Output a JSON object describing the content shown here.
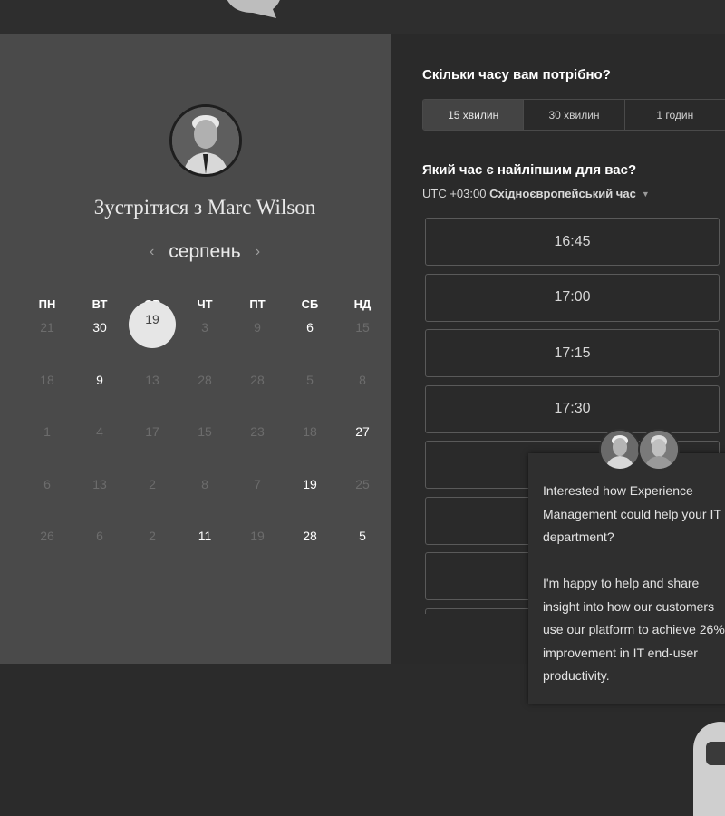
{
  "left": {
    "title": "Зустрітися з Marc Wilson",
    "month": "серпень",
    "weekdays": [
      "ПН",
      "ВТ",
      "СР",
      "ЧТ",
      "ПТ",
      "СБ",
      "НД"
    ],
    "weeks": [
      [
        {
          "d": "21",
          "a": false
        },
        {
          "d": "30",
          "a": true
        },
        {
          "d": "19",
          "a": true,
          "sel": true
        },
        {
          "d": "3",
          "a": false
        },
        {
          "d": "9",
          "a": false
        },
        {
          "d": "6",
          "a": true
        },
        {
          "d": "15",
          "a": false
        }
      ],
      [
        {
          "d": "18",
          "a": false
        },
        {
          "d": "9",
          "a": true
        },
        {
          "d": "13",
          "a": false
        },
        {
          "d": "28",
          "a": false
        },
        {
          "d": "28",
          "a": false
        },
        {
          "d": "5",
          "a": false
        },
        {
          "d": "8",
          "a": false
        }
      ],
      [
        {
          "d": "1",
          "a": false
        },
        {
          "d": "4",
          "a": false
        },
        {
          "d": "17",
          "a": false
        },
        {
          "d": "15",
          "a": false
        },
        {
          "d": "23",
          "a": false
        },
        {
          "d": "18",
          "a": false
        },
        {
          "d": "27",
          "a": true
        }
      ],
      [
        {
          "d": "6",
          "a": false
        },
        {
          "d": "13",
          "a": false
        },
        {
          "d": "2",
          "a": false
        },
        {
          "d": "8",
          "a": false
        },
        {
          "d": "7",
          "a": false
        },
        {
          "d": "19",
          "a": true
        },
        {
          "d": "25",
          "a": false
        }
      ],
      [
        {
          "d": "26",
          "a": false
        },
        {
          "d": "6",
          "a": false
        },
        {
          "d": "2",
          "a": false
        },
        {
          "d": "11",
          "a": true
        },
        {
          "d": "19",
          "a": false
        },
        {
          "d": "28",
          "a": true
        },
        {
          "d": "5",
          "a": true
        }
      ]
    ]
  },
  "right": {
    "duration_question": "Скільки часу вам потрібно?",
    "durations": [
      {
        "label": "15 хвилин",
        "active": true
      },
      {
        "label": "30 хвилин",
        "active": false
      },
      {
        "label": "1 годин",
        "active": false
      }
    ],
    "time_question": "Який час є найліпшим для вас?",
    "timezone_offset": "UTC +03:00",
    "timezone_name": "Східноєвропейський час",
    "slots": [
      "16:45",
      "17:00",
      "17:15",
      "17:30",
      "",
      "",
      "",
      ""
    ]
  },
  "chat": {
    "text1": "Interested how Experience Management could help your IT department?",
    "text2": "I'm happy to help and share insight into how our customers use our platform to achieve 26% improvement in IT end-user productivity."
  },
  "colors": {
    "left_panel_bg": "#4a4a4a",
    "right_panel_bg": "#2a2a2a",
    "selected_day": "#e6e6e6"
  },
  "icons": {
    "prev": "chevron-left-icon",
    "next": "chevron-right-icon",
    "dropdown": "caret-down-icon",
    "chat_launcher": "chat-bubble-icon"
  }
}
